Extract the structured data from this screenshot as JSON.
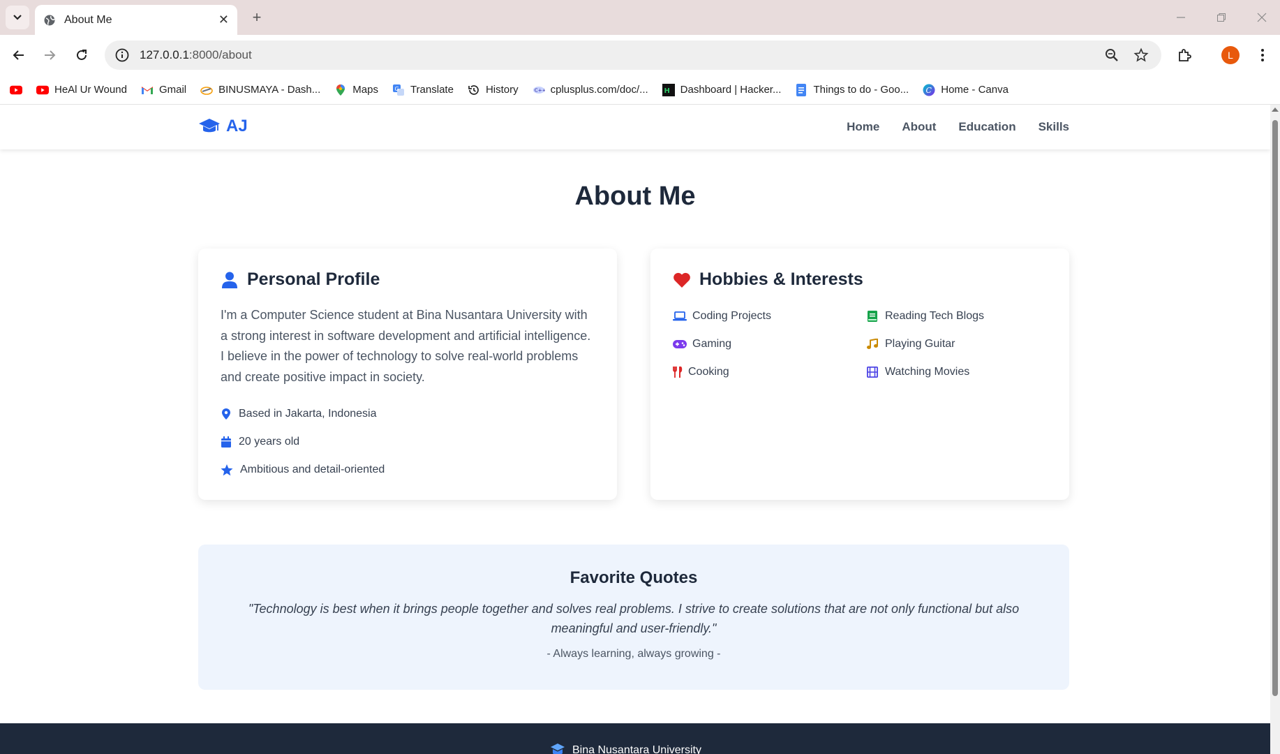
{
  "browser": {
    "tab_title": "About Me",
    "new_tab_symbol": "+",
    "tab_close_symbol": "✕",
    "url_host": "127.0.0.1",
    "url_path": ":8000/about",
    "profile_initial": "L",
    "bookmarks": [
      {
        "label": "",
        "icon": "youtube-icon"
      },
      {
        "label": "HeAl Ur Wound",
        "icon": "youtube-icon"
      },
      {
        "label": "Gmail",
        "icon": "gmail-icon"
      },
      {
        "label": "BINUSMAYA - Dash...",
        "icon": "binusmaya-icon"
      },
      {
        "label": "Maps",
        "icon": "maps-icon"
      },
      {
        "label": "Translate",
        "icon": "translate-icon"
      },
      {
        "label": "History",
        "icon": "history-icon"
      },
      {
        "label": "cplusplus.com/doc/...",
        "icon": "cplusplus-icon"
      },
      {
        "label": "Dashboard | Hacker...",
        "icon": "hackerrank-icon"
      },
      {
        "label": "Things to do - Goo...",
        "icon": "docs-icon"
      },
      {
        "label": "Home - Canva",
        "icon": "canva-icon"
      }
    ]
  },
  "site": {
    "brand": "AJ",
    "nav": [
      "Home",
      "About",
      "Education",
      "Skills"
    ],
    "page_title": "About Me",
    "profile": {
      "heading": "Personal Profile",
      "bio": "I'm a Computer Science student at Bina Nusantara University with a strong interest in software development and artificial intelligence. I believe in the power of technology to solve real-world problems and create positive impact in society.",
      "facts": [
        {
          "text": "Based in Jakarta, Indonesia",
          "icon": "location-pin-icon"
        },
        {
          "text": "20 years old",
          "icon": "calendar-icon"
        },
        {
          "text": "Ambitious and detail-oriented",
          "icon": "star-icon"
        }
      ]
    },
    "hobbies": {
      "heading": "Hobbies & Interests",
      "items": [
        {
          "text": "Coding Projects",
          "icon": "laptop-icon",
          "color": "#2563eb"
        },
        {
          "text": "Reading Tech Blogs",
          "icon": "book-icon",
          "color": "#16a34a"
        },
        {
          "text": "Gaming",
          "icon": "gamepad-icon",
          "color": "#7c3aed"
        },
        {
          "text": "Playing Guitar",
          "icon": "music-icon",
          "color": "#ca8a04"
        },
        {
          "text": "Cooking",
          "icon": "utensils-icon",
          "color": "#dc2626"
        },
        {
          "text": "Watching Movies",
          "icon": "film-icon",
          "color": "#4f46e5"
        }
      ]
    },
    "quotes": {
      "heading": "Favorite Quotes",
      "text": "\"Technology is best when it brings people together and solves real problems. I strive to create solutions that are not only functional but also meaningful and user-friendly.\"",
      "signature": "- Always learning, always growing -"
    },
    "footer": {
      "brand": "Bina Nusantara University"
    }
  },
  "colors": {
    "accent": "#2563eb",
    "heart": "#dc2626",
    "footer_bg": "#1e293b",
    "quote_bg": "#eef4fd"
  }
}
